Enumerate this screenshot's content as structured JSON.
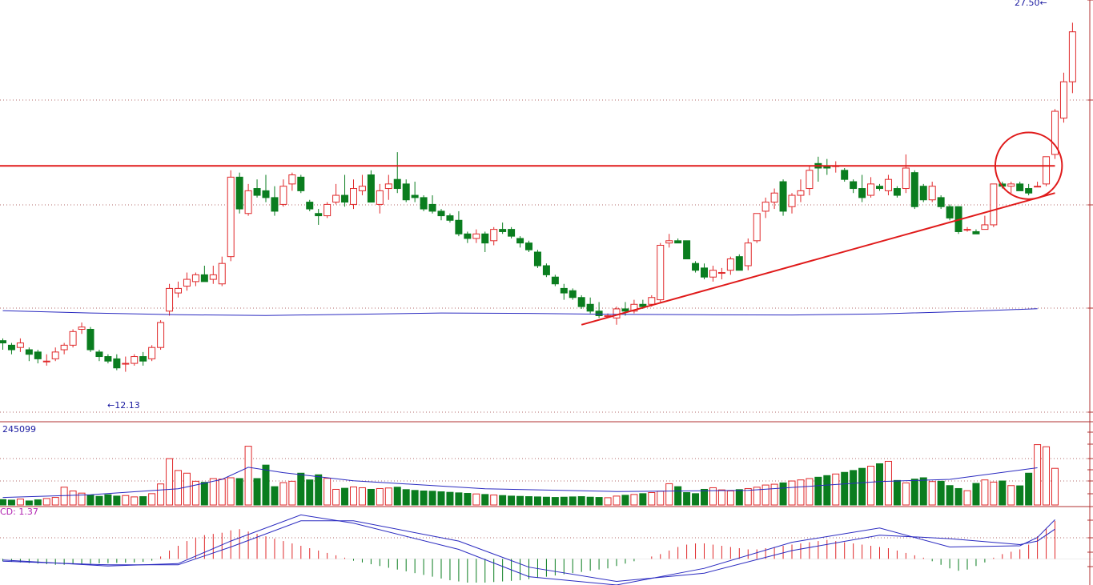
{
  "chart_data": [
    {
      "type": "candlestick",
      "title": "",
      "ylim": [
        10,
        28.5
      ],
      "price_annotations": {
        "high_label": "27.50",
        "low_label": "12.13"
      },
      "candles": [
        [
          13.5,
          13.6,
          13.1,
          13.4
        ],
        [
          13.3,
          13.4,
          12.9,
          13.1
        ],
        [
          13.2,
          13.6,
          13.0,
          13.4
        ],
        [
          13.1,
          13.2,
          12.6,
          12.9
        ],
        [
          13.0,
          13.1,
          12.5,
          12.7
        ],
        [
          12.6,
          12.9,
          12.4,
          12.6
        ],
        [
          12.7,
          13.2,
          12.6,
          13.0
        ],
        [
          13.1,
          13.4,
          12.9,
          13.3
        ],
        [
          13.3,
          14.0,
          13.2,
          13.9
        ],
        [
          14.0,
          14.3,
          13.8,
          14.1
        ],
        [
          14.0,
          14.1,
          13.0,
          13.1
        ],
        [
          13.0,
          13.1,
          12.6,
          12.8
        ],
        [
          12.8,
          12.9,
          12.5,
          12.6
        ],
        [
          12.7,
          12.9,
          12.2,
          12.3
        ],
        [
          12.5,
          12.8,
          12.13,
          12.5
        ],
        [
          12.5,
          12.9,
          12.4,
          12.8
        ],
        [
          12.8,
          13.0,
          12.4,
          12.6
        ],
        [
          12.7,
          13.3,
          12.6,
          13.2
        ],
        [
          13.2,
          14.4,
          13.1,
          14.3
        ],
        [
          14.8,
          16.0,
          14.6,
          15.8
        ],
        [
          15.6,
          16.1,
          15.4,
          15.8
        ],
        [
          15.9,
          16.5,
          15.7,
          16.2
        ],
        [
          16.1,
          16.5,
          15.9,
          16.4
        ],
        [
          16.4,
          16.8,
          16.1,
          16.1
        ],
        [
          16.2,
          16.8,
          16.0,
          16.4
        ],
        [
          16.0,
          17.2,
          15.9,
          16.9
        ],
        [
          17.2,
          21.0,
          17.0,
          20.7
        ],
        [
          20.7,
          20.9,
          19.1,
          19.3
        ],
        [
          19.1,
          20.4,
          19.0,
          20.1
        ],
        [
          20.2,
          20.6,
          19.8,
          19.9
        ],
        [
          20.1,
          20.8,
          19.6,
          19.8
        ],
        [
          19.8,
          20.3,
          19.0,
          19.2
        ],
        [
          19.5,
          20.6,
          19.4,
          20.3
        ],
        [
          20.4,
          20.9,
          20.1,
          20.8
        ],
        [
          20.7,
          20.8,
          20.0,
          20.1
        ],
        [
          19.6,
          19.7,
          19.2,
          19.3
        ],
        [
          19.1,
          19.3,
          18.6,
          19.0
        ],
        [
          19.0,
          19.6,
          18.9,
          19.5
        ],
        [
          19.6,
          20.4,
          19.5,
          19.9
        ],
        [
          19.9,
          20.8,
          19.4,
          19.6
        ],
        [
          19.5,
          20.6,
          19.3,
          20.2
        ],
        [
          20.1,
          20.8,
          19.9,
          20.3
        ],
        [
          20.8,
          21.0,
          19.6,
          19.6
        ],
        [
          19.5,
          20.4,
          19.1,
          20.1
        ],
        [
          20.2,
          20.8,
          19.7,
          20.4
        ],
        [
          20.6,
          21.8,
          20.0,
          20.2
        ],
        [
          20.4,
          20.6,
          19.6,
          19.7
        ],
        [
          19.9,
          20.5,
          19.6,
          19.8
        ],
        [
          19.8,
          19.9,
          19.2,
          19.3
        ],
        [
          19.5,
          19.9,
          19.1,
          19.2
        ],
        [
          19.2,
          19.3,
          18.8,
          19.0
        ],
        [
          19.0,
          19.1,
          18.7,
          18.8
        ],
        [
          18.8,
          19.2,
          18.1,
          18.2
        ],
        [
          18.2,
          18.3,
          17.8,
          18.0
        ],
        [
          18.0,
          18.4,
          17.8,
          18.2
        ],
        [
          18.2,
          18.3,
          17.4,
          17.8
        ],
        [
          17.9,
          18.5,
          17.7,
          18.4
        ],
        [
          18.4,
          18.7,
          18.2,
          18.3
        ],
        [
          18.4,
          18.5,
          18.0,
          18.1
        ],
        [
          18.0,
          18.1,
          17.6,
          17.8
        ],
        [
          17.8,
          17.9,
          17.4,
          17.5
        ],
        [
          17.4,
          17.5,
          16.7,
          16.8
        ],
        [
          16.8,
          16.9,
          16.3,
          16.4
        ],
        [
          16.3,
          16.4,
          15.9,
          16.0
        ],
        [
          15.8,
          16.0,
          15.3,
          15.6
        ],
        [
          15.7,
          15.8,
          15.3,
          15.4
        ],
        [
          15.4,
          15.5,
          14.9,
          15.0
        ],
        [
          15.1,
          15.4,
          14.7,
          14.8
        ],
        [
          14.8,
          15.2,
          14.5,
          14.6
        ],
        [
          14.6,
          14.7,
          14.6,
          14.6
        ],
        [
          14.5,
          15.0,
          14.2,
          14.9
        ],
        [
          14.9,
          15.2,
          14.6,
          14.8
        ],
        [
          14.8,
          15.3,
          14.7,
          15.1
        ],
        [
          15.1,
          15.3,
          14.9,
          15.0
        ],
        [
          15.1,
          15.5,
          15.0,
          15.4
        ],
        [
          15.3,
          17.8,
          15.2,
          17.7
        ],
        [
          17.8,
          18.2,
          17.6,
          17.9
        ],
        [
          17.9,
          18.0,
          17.8,
          17.8
        ],
        [
          17.9,
          17.9,
          17.1,
          17.1
        ],
        [
          16.9,
          17.0,
          16.5,
          16.6
        ],
        [
          16.7,
          16.9,
          16.2,
          16.3
        ],
        [
          16.3,
          16.8,
          16.1,
          16.6
        ],
        [
          16.5,
          16.7,
          16.2,
          16.5
        ],
        [
          16.6,
          17.2,
          16.4,
          17.1
        ],
        [
          17.2,
          17.3,
          16.6,
          16.6
        ],
        [
          16.8,
          18.0,
          16.6,
          17.8
        ],
        [
          17.9,
          19.1,
          17.8,
          19.1
        ],
        [
          19.2,
          19.8,
          18.9,
          19.6
        ],
        [
          19.6,
          20.2,
          19.3,
          20.0
        ],
        [
          20.5,
          20.6,
          19.0,
          19.2
        ],
        [
          19.4,
          20.0,
          19.1,
          19.9
        ],
        [
          19.9,
          20.6,
          19.6,
          20.1
        ],
        [
          20.2,
          21.2,
          19.9,
          21.0
        ],
        [
          21.3,
          21.6,
          20.5,
          21.1
        ],
        [
          21.2,
          21.5,
          20.8,
          21.1
        ],
        [
          21.2,
          21.4,
          20.9,
          21.2
        ],
        [
          21.0,
          21.1,
          20.5,
          20.6
        ],
        [
          20.5,
          20.6,
          20.0,
          20.2
        ],
        [
          20.2,
          20.8,
          19.6,
          19.8
        ],
        [
          19.9,
          20.7,
          19.8,
          20.4
        ],
        [
          20.3,
          20.4,
          20.1,
          20.2
        ],
        [
          20.1,
          20.8,
          19.9,
          20.6
        ],
        [
          20.2,
          20.3,
          19.8,
          19.9
        ],
        [
          20.2,
          21.7,
          20.0,
          21.1
        ],
        [
          20.9,
          21.0,
          19.3,
          19.4
        ],
        [
          20.3,
          20.4,
          19.6,
          19.7
        ],
        [
          19.7,
          20.5,
          19.6,
          20.3
        ],
        [
          19.8,
          19.9,
          19.3,
          19.4
        ],
        [
          19.4,
          19.5,
          18.8,
          18.9
        ],
        [
          19.4,
          19.4,
          18.2,
          18.3
        ],
        [
          18.4,
          18.5,
          18.3,
          18.4
        ],
        [
          18.3,
          18.4,
          18.2,
          18.2
        ],
        [
          18.4,
          19.0,
          18.4,
          18.6
        ],
        [
          18.6,
          20.4,
          18.5,
          20.4
        ],
        [
          20.4,
          20.5,
          20.2,
          20.3
        ],
        [
          20.3,
          20.5,
          20.0,
          20.4
        ],
        [
          20.4,
          20.5,
          20.1,
          20.1
        ],
        [
          20.2,
          20.4,
          19.9,
          20.0
        ],
        [
          20.3,
          20.5,
          20.3,
          20.3
        ],
        [
          20.4,
          21.6,
          20.3,
          21.6
        ],
        [
          21.7,
          23.7,
          21.5,
          23.6
        ],
        [
          23.3,
          25.3,
          23.1,
          24.9
        ],
        [
          24.9,
          27.5,
          24.4,
          27.1
        ]
      ],
      "ma_line": [
        [
          0,
          14.82
        ],
        [
          10,
          14.72
        ],
        [
          20,
          14.64
        ],
        [
          30,
          14.61
        ],
        [
          40,
          14.66
        ],
        [
          50,
          14.72
        ],
        [
          60,
          14.7
        ],
        [
          70,
          14.66
        ],
        [
          80,
          14.64
        ],
        [
          90,
          14.63
        ],
        [
          100,
          14.68
        ],
        [
          110,
          14.79
        ],
        [
          118,
          14.91
        ]
      ],
      "resistance_line": [
        [
          -3,
          21.2
        ],
        [
          120,
          21.2
        ]
      ],
      "support_line": [
        [
          66,
          14.2
        ],
        [
          120,
          20.0
        ]
      ],
      "circle_marker": {
        "center": [
          117,
          21.2
        ],
        "radius_price": 1.4
      }
    },
    {
      "type": "bar",
      "label": "245099",
      "ylim": [
        0,
        300000
      ],
      "volumes": [
        20000,
        18000,
        22000,
        15000,
        19000,
        24000,
        28000,
        66000,
        52000,
        44000,
        36000,
        32000,
        38000,
        33000,
        35000,
        30000,
        31000,
        42000,
        78000,
        172000,
        128000,
        118000,
        88000,
        84000,
        98000,
        96000,
        101000,
        98000,
        218000,
        98000,
        148000,
        68000,
        83000,
        88000,
        118000,
        93000,
        112000,
        99000,
        58000,
        62000,
        67000,
        64000,
        58000,
        61000,
        63000,
        66000,
        57000,
        54000,
        52000,
        51000,
        49000,
        47000,
        45000,
        43000,
        41000,
        39000,
        37000,
        35000,
        33000,
        32000,
        31000,
        30000,
        29000,
        28000,
        29000,
        30000,
        31000,
        29000,
        28000,
        27000,
        33000,
        36000,
        39000,
        42000,
        46000,
        51000,
        79000,
        68000,
        46000,
        42000,
        58000,
        64000,
        56000,
        52000,
        57000,
        61000,
        66000,
        74000,
        77000,
        82000,
        89000,
        93000,
        98000,
        103000,
        109000,
        115000,
        121000,
        128000,
        136000,
        144000,
        153000,
        162000,
        91000,
        82000,
        96000,
        101000,
        87000,
        88000,
        72000,
        61000,
        53000,
        80000,
        93000,
        85000,
        89000,
        72000,
        71000,
        118000,
        224000,
        216000,
        136000
      ],
      "ma_line": [
        [
          0,
          28000
        ],
        [
          10,
          38000
        ],
        [
          20,
          60000
        ],
        [
          25,
          95000
        ],
        [
          28,
          140000
        ],
        [
          32,
          120000
        ],
        [
          40,
          90000
        ],
        [
          55,
          60000
        ],
        [
          70,
          50000
        ],
        [
          85,
          54000
        ],
        [
          100,
          87000
        ],
        [
          108,
          95000
        ],
        [
          118,
          138000
        ]
      ]
    },
    {
      "type": "macd",
      "label": "CD: 1.37",
      "ylim": [
        -2.2,
        4.2
      ],
      "histogram": [
        -0.2,
        -0.25,
        -0.3,
        -0.35,
        -0.4,
        -0.45,
        -0.5,
        -0.5,
        -0.45,
        -0.42,
        -0.4,
        -0.38,
        -0.36,
        -0.34,
        -0.32,
        -0.3,
        -0.25,
        -0.15,
        0.2,
        0.7,
        1.1,
        1.5,
        1.8,
        2.0,
        2.1,
        2.2,
        2.4,
        2.5,
        2.3,
        2.1,
        1.9,
        1.7,
        1.5,
        1.3,
        1.1,
        0.9,
        0.7,
        0.5,
        0.3,
        0.1,
        -0.15,
        -0.3,
        -0.45,
        -0.6,
        -0.75,
        -0.9,
        -1.05,
        -1.2,
        -1.35,
        -1.5,
        -1.65,
        -1.8,
        -1.9,
        -2.0,
        -2.0,
        -2.0,
        -1.95,
        -1.9,
        -1.85,
        -1.8,
        -1.7,
        -1.6,
        -1.5,
        -1.4,
        -1.3,
        -1.2,
        -1.1,
        -1.0,
        -0.9,
        -0.8,
        -0.6,
        -0.4,
        -0.2,
        0.0,
        0.2,
        0.4,
        0.7,
        1.0,
        1.2,
        1.3,
        1.3,
        1.2,
        1.1,
        1.0,
        0.9,
        0.8,
        0.8,
        0.9,
        1.0,
        1.1,
        1.2,
        1.3,
        1.4,
        1.5,
        1.6,
        1.5,
        1.4,
        1.3,
        1.2,
        1.1,
        1.0,
        0.9,
        0.7,
        0.5,
        0.3,
        0.1,
        -0.2,
        -0.5,
        -0.8,
        -1.0,
        -0.9,
        -0.6,
        -0.3,
        0.1,
        0.4,
        0.6,
        0.8,
        1.2,
        1.9,
        2.6,
        3.2
      ],
      "dif_line": [
        [
          0,
          -0.1
        ],
        [
          12,
          -0.6
        ],
        [
          20,
          -0.4
        ],
        [
          26,
          1.5
        ],
        [
          34,
          3.7
        ],
        [
          40,
          3.0
        ],
        [
          52,
          0.8
        ],
        [
          60,
          -1.5
        ],
        [
          70,
          -2.2
        ],
        [
          80,
          -0.8
        ],
        [
          90,
          1.4
        ],
        [
          100,
          2.6
        ],
        [
          108,
          1.0
        ],
        [
          116,
          1.1
        ],
        [
          118,
          1.8
        ],
        [
          120,
          3.3
        ]
      ],
      "dea_line": [
        [
          0,
          -0.2
        ],
        [
          12,
          -0.5
        ],
        [
          20,
          -0.5
        ],
        [
          26,
          1.0
        ],
        [
          34,
          3.2
        ],
        [
          40,
          3.2
        ],
        [
          52,
          1.5
        ],
        [
          60,
          -0.7
        ],
        [
          70,
          -1.9
        ],
        [
          80,
          -1.2
        ],
        [
          90,
          0.7
        ],
        [
          100,
          2.0
        ],
        [
          108,
          1.7
        ],
        [
          116,
          1.2
        ],
        [
          118,
          1.5
        ],
        [
          120,
          2.5
        ]
      ]
    }
  ],
  "colors": {
    "up": "#e0282a",
    "down": "#0a7d1f",
    "ma": "#2a2ac0",
    "trend": "#e01b1b",
    "label": "#1a1aa0",
    "macd_label": "#b020b0",
    "grid": "#9a3a3a"
  }
}
